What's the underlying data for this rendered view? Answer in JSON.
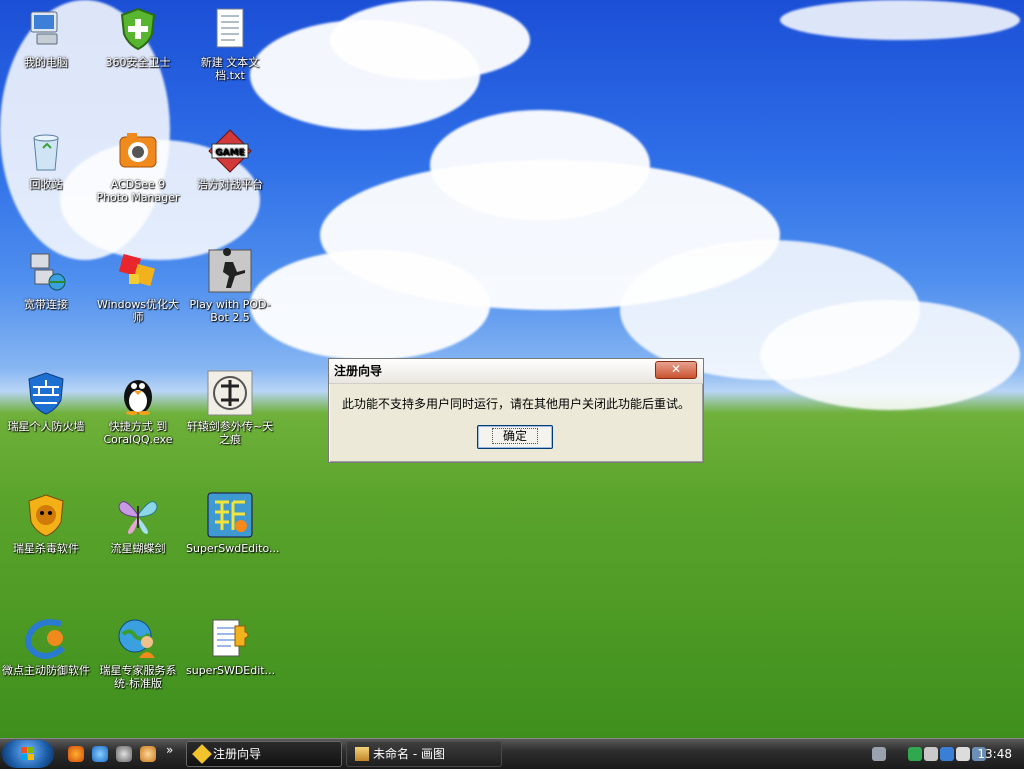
{
  "desktop": {
    "icons": [
      {
        "label": "我的电脑"
      },
      {
        "label": "360安全卫士"
      },
      {
        "label": "新建 文本文档.txt"
      },
      {
        "label": "回收站"
      },
      {
        "label": "ACDSee 9 Photo Manager"
      },
      {
        "label": "浩方对战平台"
      },
      {
        "label": "宽带连接"
      },
      {
        "label": "Windows优化大师"
      },
      {
        "label": "Play with POD-Bot 2.5"
      },
      {
        "label": "瑞星个人防火墙"
      },
      {
        "label": "快捷方式 到 CoralQQ.exe"
      },
      {
        "label": "轩辕剑参外传~天之痕"
      },
      {
        "label": "瑞星杀毒软件"
      },
      {
        "label": "流星蝴蝶剑"
      },
      {
        "label": "SuperSwdEdito..."
      },
      {
        "label": "微点主动防御软件"
      },
      {
        "label": "瑞星专家服务系统-标准版"
      },
      {
        "label": "superSWDEdit..."
      }
    ]
  },
  "dialog": {
    "title": "注册向导",
    "message": "此功能不支持多用户同时运行，请在其他用户关闭此功能后重试。",
    "ok_label": "确定",
    "close_glyph": "✕"
  },
  "taskbar": {
    "tasks": [
      {
        "label": "注册向导"
      },
      {
        "label": "未命名 - 画图"
      }
    ],
    "quicklaunch_more": "»",
    "clock": "13:48"
  }
}
